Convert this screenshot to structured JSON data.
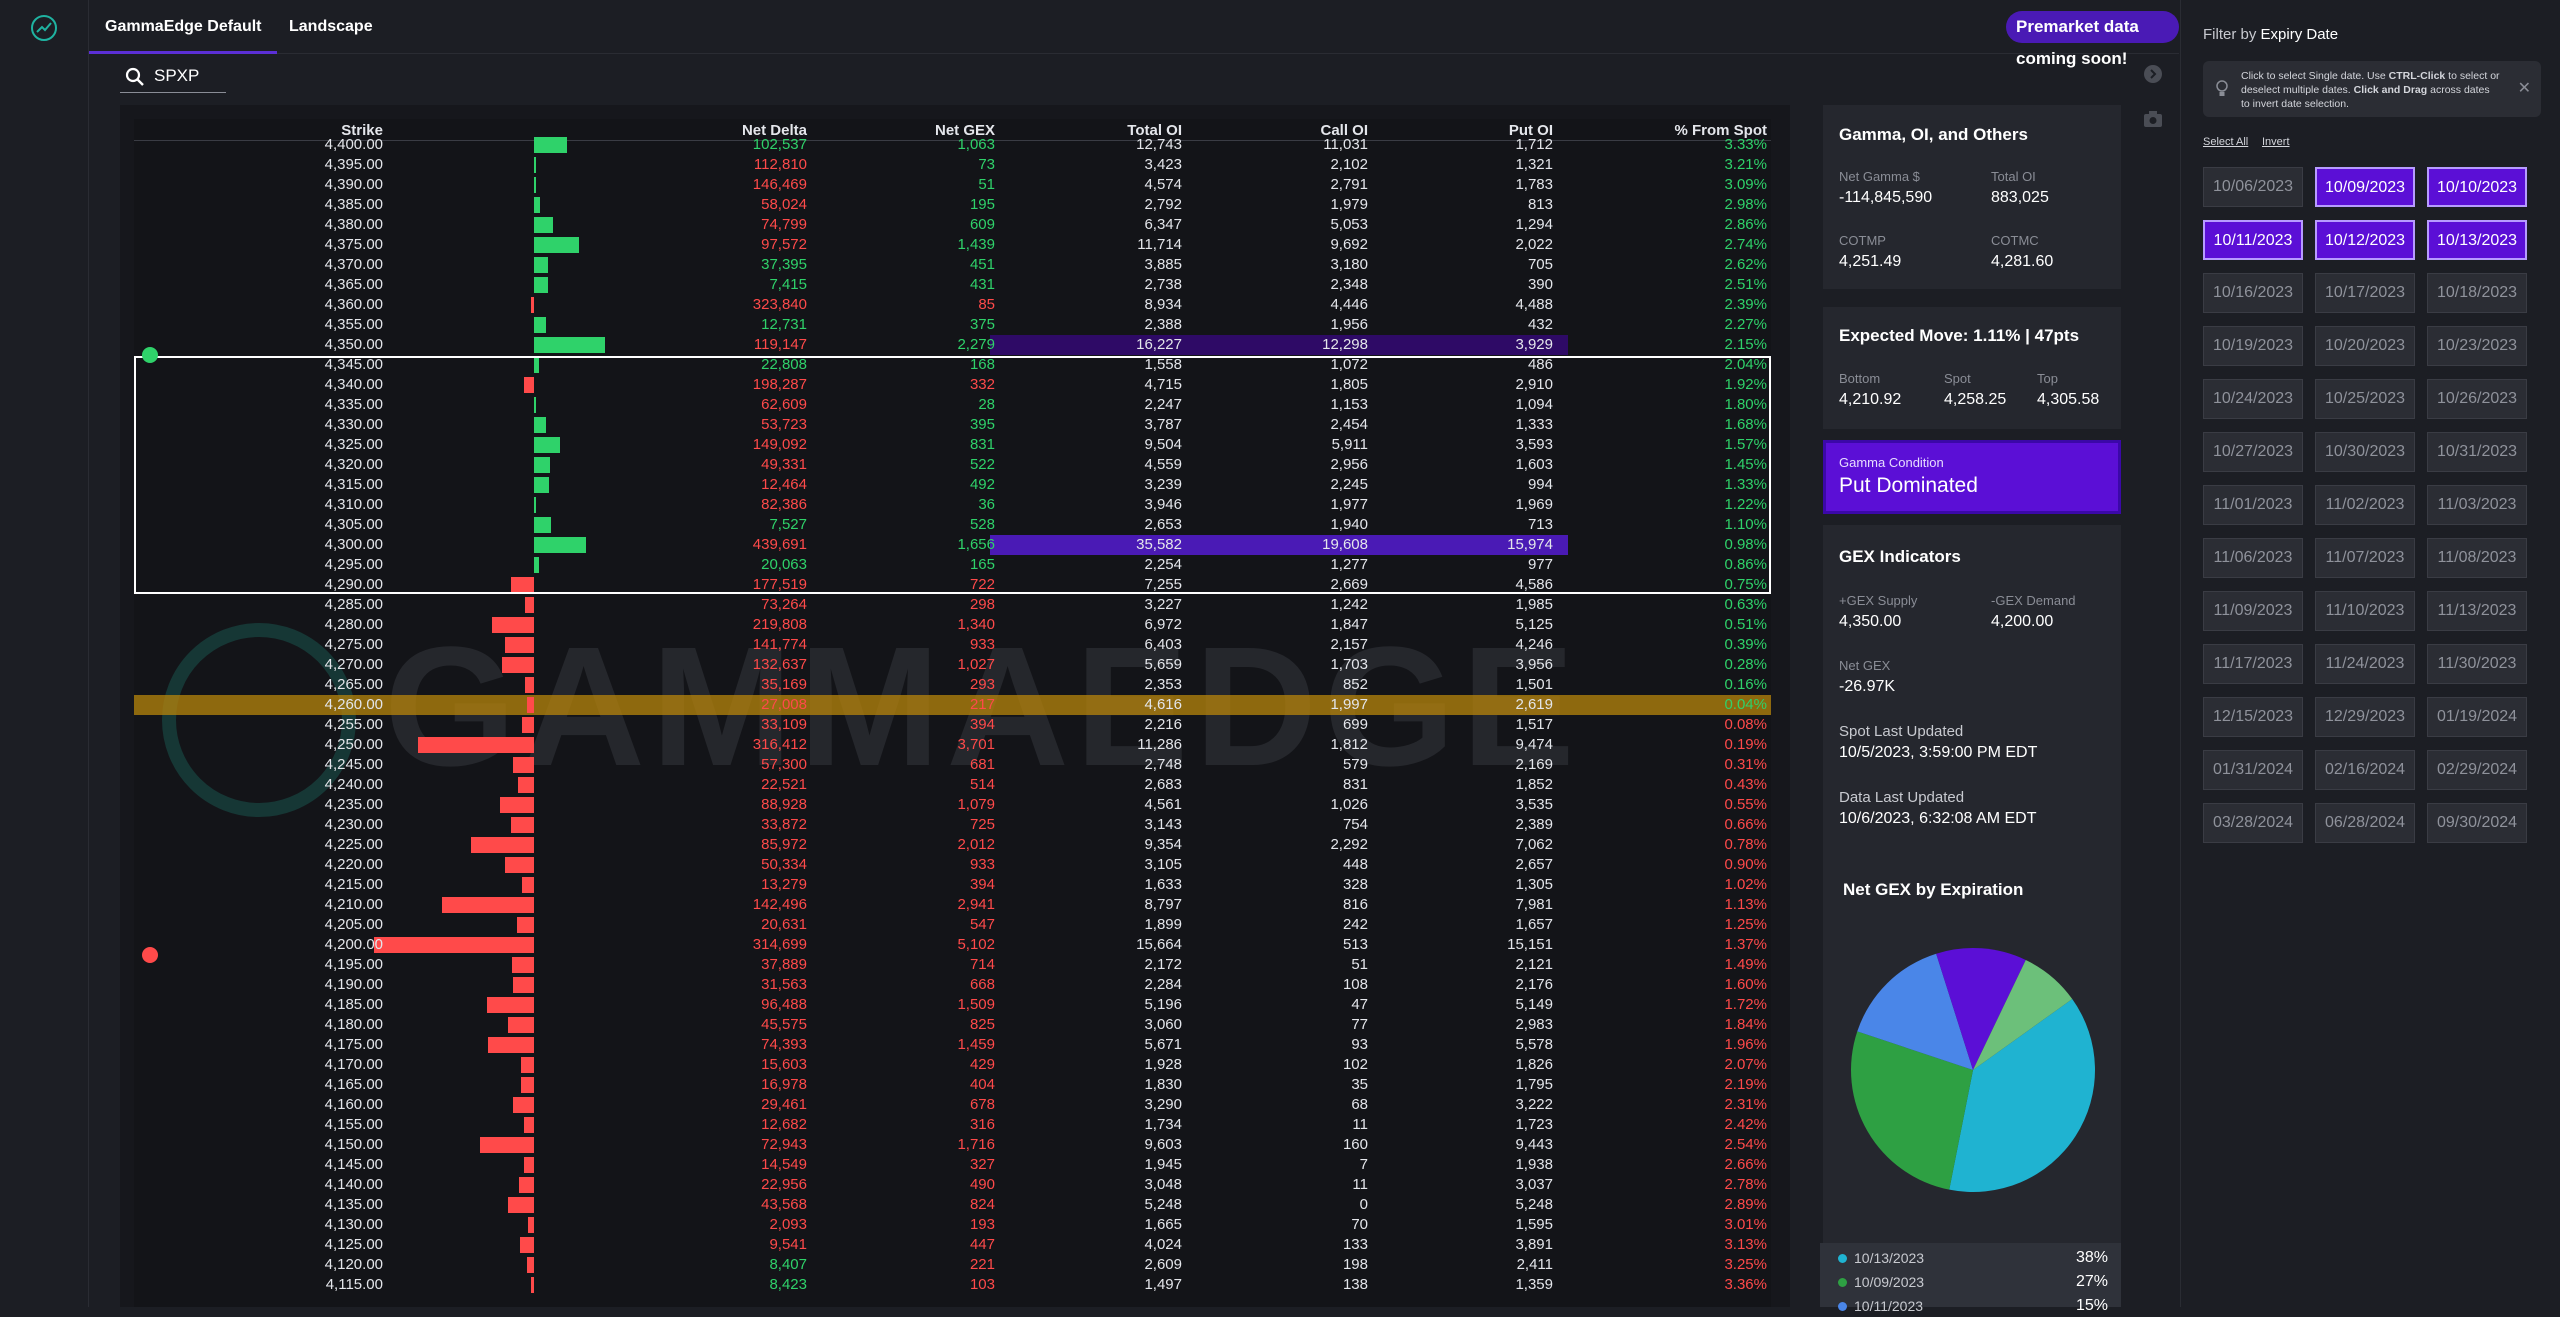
{
  "nav": {
    "tabs": [
      "GammaEdge Default",
      "Landscape"
    ],
    "active_tab": 0,
    "premarket_banner": "Premarket data coming soon!"
  },
  "search": {
    "value": "SPXP"
  },
  "table": {
    "columns": [
      "Strike",
      "Net Delta",
      "Net GEX",
      "Total OI",
      "Call OI",
      "Put OI",
      "% From Spot"
    ],
    "rows": [
      [
        "4,400.00",
        "102,537",
        "1,063",
        "12,743",
        "11,031",
        "1,712",
        "3.33%"
      ],
      [
        "4,395.00",
        "112,810",
        "73",
        "3,423",
        "2,102",
        "1,321",
        "3.21%"
      ],
      [
        "4,390.00",
        "146,469",
        "51",
        "4,574",
        "2,791",
        "1,783",
        "3.09%"
      ],
      [
        "4,385.00",
        "58,024",
        "195",
        "2,792",
        "1,979",
        "813",
        "2.98%"
      ],
      [
        "4,380.00",
        "74,799",
        "609",
        "6,347",
        "5,053",
        "1,294",
        "2.86%"
      ],
      [
        "4,375.00",
        "97,572",
        "1,439",
        "11,714",
        "9,692",
        "2,022",
        "2.74%"
      ],
      [
        "4,370.00",
        "37,395",
        "451",
        "3,885",
        "3,180",
        "705",
        "2.62%"
      ],
      [
        "4,365.00",
        "7,415",
        "431",
        "2,738",
        "2,348",
        "390",
        "2.51%"
      ],
      [
        "4,360.00",
        "323,840",
        "85",
        "8,934",
        "4,446",
        "4,488",
        "2.39%"
      ],
      [
        "4,355.00",
        "12,731",
        "375",
        "2,388",
        "1,956",
        "432",
        "2.27%"
      ],
      [
        "4,350.00",
        "119,147",
        "2,279",
        "16,227",
        "12,298",
        "3,929",
        "2.15%"
      ],
      [
        "4,345.00",
        "22,808",
        "168",
        "1,558",
        "1,072",
        "486",
        "2.04%"
      ],
      [
        "4,340.00",
        "198,287",
        "332",
        "4,715",
        "1,805",
        "2,910",
        "1.92%"
      ],
      [
        "4,335.00",
        "62,609",
        "28",
        "2,247",
        "1,153",
        "1,094",
        "1.80%"
      ],
      [
        "4,330.00",
        "53,723",
        "395",
        "3,787",
        "2,454",
        "1,333",
        "1.68%"
      ],
      [
        "4,325.00",
        "149,092",
        "831",
        "9,504",
        "5,911",
        "3,593",
        "1.57%"
      ],
      [
        "4,320.00",
        "49,331",
        "522",
        "4,559",
        "2,956",
        "1,603",
        "1.45%"
      ],
      [
        "4,315.00",
        "12,464",
        "492",
        "3,239",
        "2,245",
        "994",
        "1.33%"
      ],
      [
        "4,310.00",
        "82,386",
        "36",
        "3,946",
        "1,977",
        "1,969",
        "1.22%"
      ],
      [
        "4,305.00",
        "7,527",
        "528",
        "2,653",
        "1,940",
        "713",
        "1.10%"
      ],
      [
        "4,300.00",
        "439,691",
        "1,656",
        "35,582",
        "19,608",
        "15,974",
        "0.98%"
      ],
      [
        "4,295.00",
        "20,063",
        "165",
        "2,254",
        "1,277",
        "977",
        "0.86%"
      ],
      [
        "4,290.00",
        "177,519",
        "722",
        "7,255",
        "2,669",
        "4,586",
        "0.75%"
      ],
      [
        "4,285.00",
        "73,264",
        "298",
        "3,227",
        "1,242",
        "1,985",
        "0.63%"
      ],
      [
        "4,280.00",
        "219,808",
        "1,340",
        "6,972",
        "1,847",
        "5,125",
        "0.51%"
      ],
      [
        "4,275.00",
        "141,774",
        "933",
        "6,403",
        "2,157",
        "4,246",
        "0.39%"
      ],
      [
        "4,270.00",
        "132,637",
        "1,027",
        "5,659",
        "1,703",
        "3,956",
        "0.28%"
      ],
      [
        "4,265.00",
        "35,169",
        "293",
        "2,353",
        "852",
        "1,501",
        "0.16%"
      ],
      [
        "4,260.00",
        "27,008",
        "217",
        "4,616",
        "1,997",
        "2,619",
        "0.04%"
      ],
      [
        "4,255.00",
        "33,109",
        "394",
        "2,216",
        "699",
        "1,517",
        "0.08%"
      ],
      [
        "4,250.00",
        "316,412",
        "3,701",
        "11,286",
        "1,812",
        "9,474",
        "0.19%"
      ],
      [
        "4,245.00",
        "57,300",
        "681",
        "2,748",
        "579",
        "2,169",
        "0.31%"
      ],
      [
        "4,240.00",
        "22,521",
        "514",
        "2,683",
        "831",
        "1,852",
        "0.43%"
      ],
      [
        "4,235.00",
        "88,928",
        "1,079",
        "4,561",
        "1,026",
        "3,535",
        "0.55%"
      ],
      [
        "4,230.00",
        "33,872",
        "725",
        "3,143",
        "754",
        "2,389",
        "0.66%"
      ],
      [
        "4,225.00",
        "85,972",
        "2,012",
        "9,354",
        "2,292",
        "7,062",
        "0.78%"
      ],
      [
        "4,220.00",
        "50,334",
        "933",
        "3,105",
        "448",
        "2,657",
        "0.90%"
      ],
      [
        "4,215.00",
        "13,279",
        "394",
        "1,633",
        "328",
        "1,305",
        "1.02%"
      ],
      [
        "4,210.00",
        "142,496",
        "2,941",
        "8,797",
        "816",
        "7,981",
        "1.13%"
      ],
      [
        "4,205.00",
        "20,631",
        "547",
        "1,899",
        "242",
        "1,657",
        "1.25%"
      ],
      [
        "4,200.00",
        "314,699",
        "5,102",
        "15,664",
        "513",
        "15,151",
        "1.37%"
      ],
      [
        "4,195.00",
        "37,889",
        "714",
        "2,172",
        "51",
        "2,121",
        "1.49%"
      ],
      [
        "4,190.00",
        "31,563",
        "668",
        "2,284",
        "108",
        "2,176",
        "1.60%"
      ],
      [
        "4,185.00",
        "96,488",
        "1,509",
        "5,196",
        "47",
        "5,149",
        "1.72%"
      ],
      [
        "4,180.00",
        "45,575",
        "825",
        "3,060",
        "77",
        "2,983",
        "1.84%"
      ],
      [
        "4,175.00",
        "74,393",
        "1,459",
        "5,671",
        "93",
        "5,578",
        "1.96%"
      ],
      [
        "4,170.00",
        "15,603",
        "429",
        "1,928",
        "102",
        "1,826",
        "2.07%"
      ],
      [
        "4,165.00",
        "16,978",
        "404",
        "1,830",
        "35",
        "1,795",
        "2.19%"
      ],
      [
        "4,160.00",
        "29,461",
        "678",
        "3,290",
        "68",
        "3,222",
        "2.31%"
      ],
      [
        "4,155.00",
        "12,682",
        "316",
        "1,734",
        "11",
        "1,723",
        "2.42%"
      ],
      [
        "4,150.00",
        "72,943",
        "1,716",
        "9,603",
        "160",
        "9,443",
        "2.54%"
      ],
      [
        "4,145.00",
        "14,549",
        "327",
        "1,945",
        "7",
        "1,938",
        "2.66%"
      ],
      [
        "4,140.00",
        "22,956",
        "490",
        "3,048",
        "11",
        "3,037",
        "2.78%"
      ],
      [
        "4,135.00",
        "43,568",
        "824",
        "5,248",
        "0",
        "5,248",
        "2.89%"
      ],
      [
        "4,130.00",
        "2,093",
        "193",
        "1,665",
        "70",
        "1,595",
        "3.01%"
      ],
      [
        "4,125.00",
        "9,541",
        "447",
        "4,024",
        "133",
        "3,891",
        "3.13%"
      ],
      [
        "4,120.00",
        "8,407",
        "221",
        "2,609",
        "198",
        "2,411",
        "3.25%"
      ],
      [
        "4,115.00",
        "8,423",
        "103",
        "1,497",
        "138",
        "1,359",
        "3.36%"
      ]
    ],
    "row_colors": [
      "g",
      "r",
      "r",
      "r",
      "r",
      "r",
      "g",
      "g",
      "r",
      "g",
      "r",
      "g",
      "r",
      "r",
      "r",
      "r",
      "r",
      "r",
      "r",
      "g",
      "r",
      "g",
      "r",
      "r",
      "r",
      "r",
      "r",
      "r",
      "r",
      "r",
      "r",
      "r",
      "r",
      "r",
      "r",
      "r",
      "r",
      "r",
      "r",
      "r",
      "r",
      "r",
      "r",
      "r",
      "r",
      "r",
      "r",
      "r",
      "r",
      "r",
      "r",
      "r",
      "r",
      "r",
      "r",
      "r",
      "g",
      "g"
    ],
    "gex_sign": [
      "g",
      "g",
      "g",
      "g",
      "g",
      "g",
      "g",
      "g",
      "r",
      "g",
      "g",
      "g",
      "r",
      "g",
      "g",
      "g",
      "g",
      "g",
      "g",
      "g",
      "g",
      "g",
      "r",
      "r",
      "r",
      "r",
      "r",
      "r",
      "r",
      "r",
      "r",
      "r",
      "r",
      "r",
      "r",
      "r",
      "r",
      "r",
      "r",
      "r",
      "r",
      "r",
      "r",
      "r",
      "r",
      "r",
      "r",
      "r",
      "r",
      "r",
      "r",
      "r",
      "r",
      "r",
      "r",
      "r",
      "r",
      "r"
    ],
    "pct_color": [
      "g",
      "g",
      "g",
      "g",
      "g",
      "g",
      "g",
      "g",
      "g",
      "g",
      "g",
      "g",
      "g",
      "g",
      "g",
      "g",
      "g",
      "g",
      "g",
      "g",
      "g",
      "g",
      "g",
      "g",
      "g",
      "g",
      "g",
      "g",
      "g",
      "r",
      "r",
      "r",
      "r",
      "r",
      "r",
      "r",
      "r",
      "r",
      "r",
      "r",
      "r",
      "r",
      "r",
      "r",
      "r",
      "r",
      "r",
      "r",
      "r",
      "r",
      "r",
      "r",
      "r",
      "r",
      "r",
      "r",
      "r",
      "r"
    ],
    "net_gex_signed": [
      1063,
      73,
      51,
      195,
      609,
      1439,
      451,
      431,
      -85,
      375,
      2279,
      168,
      -332,
      28,
      395,
      831,
      522,
      492,
      36,
      528,
      1656,
      165,
      -722,
      -298,
      -1340,
      -933,
      -1027,
      -293,
      -217,
      -394,
      -3701,
      -681,
      -514,
      -1079,
      -725,
      -2012,
      -933,
      -394,
      -2941,
      -547,
      -5102,
      -714,
      -668,
      -1509,
      -825,
      -1459,
      -429,
      -404,
      -678,
      -316,
      -1716,
      -327,
      -490,
      -824,
      -193,
      -447,
      -221,
      -103
    ],
    "highlight_rows": [
      10,
      20
    ],
    "spot_row": 28
  },
  "watermark": "GAMMAEDGE",
  "gamma_card": {
    "title": "Gamma, OI, and Others",
    "net_gamma_label": "Net Gamma $",
    "net_gamma": "-114,845,590",
    "total_oi_label": "Total OI",
    "total_oi": "883,025",
    "cotmp_label": "COTMP",
    "cotmp": "4,251.49",
    "cotmc_label": "COTMC",
    "cotmc": "4,281.60"
  },
  "move_card": {
    "title": "Expected Move: 1.11% | 47pts",
    "bottom_label": "Bottom",
    "bottom": "4,210.92",
    "spot_label": "Spot",
    "spot": "4,258.25",
    "top_label": "Top",
    "top": "4,305.58"
  },
  "condition": {
    "label": "Gamma Condition",
    "value": "Put Dominated"
  },
  "gex_card": {
    "title": "GEX Indicators",
    "supply_label": "+GEX Supply",
    "supply": "4,350.00",
    "demand_label": "-GEX Demand",
    "demand": "4,200.00",
    "net_gex_label": "Net GEX",
    "net_gex": "-26.97K",
    "spot_updated_label": "Spot Last Updated",
    "spot_updated": "10/5/2023, 3:59:00 PM EDT",
    "data_updated_label": "Data Last Updated",
    "data_updated": "10/6/2023, 6:32:08 AM EDT"
  },
  "pie_card": {
    "title": "Net GEX by Expiration"
  },
  "chart_data": {
    "type": "pie",
    "title": "Net GEX by Expiration",
    "slices": [
      {
        "label": "10/13/2023",
        "value": 38,
        "color": "#1fb3d1"
      },
      {
        "label": "10/09/2023",
        "value": 27,
        "color": "#2ea043"
      },
      {
        "label": "10/11/2023",
        "value": 15,
        "color": "#4a86e8"
      },
      {
        "label": "",
        "value": 12,
        "color": "#5b0fd6"
      },
      {
        "label": "",
        "value": 8,
        "color": "#6cc07a"
      }
    ],
    "legend": [
      {
        "label": "10/13/2023",
        "pct": "38%",
        "color": "#1fb3d1"
      },
      {
        "label": "10/09/2023",
        "pct": "27%",
        "color": "#2ea043"
      },
      {
        "label": "10/11/2023",
        "pct": "15%",
        "color": "#4a86e8"
      }
    ]
  },
  "filter": {
    "title_prefix": "Filter by ",
    "title_bold": "Expiry Date",
    "hint_a": "Click to select Single date. Use ",
    "hint_b": "CTRL-Click",
    "hint_c": " to select or deselect multiple dates. ",
    "hint_d": "Click and Drag",
    "hint_e": " across dates to invert date selection.",
    "select_all": "Select All",
    "invert": "Invert",
    "dates": [
      "10/06/2023",
      "10/09/2023",
      "10/10/2023",
      "10/11/2023",
      "10/12/2023",
      "10/13/2023",
      "10/16/2023",
      "10/17/2023",
      "10/18/2023",
      "10/19/2023",
      "10/20/2023",
      "10/23/2023",
      "10/24/2023",
      "10/25/2023",
      "10/26/2023",
      "10/27/2023",
      "10/30/2023",
      "10/31/2023",
      "11/01/2023",
      "11/02/2023",
      "11/03/2023",
      "11/06/2023",
      "11/07/2023",
      "11/08/2023",
      "11/09/2023",
      "11/10/2023",
      "11/13/2023",
      "11/17/2023",
      "11/24/2023",
      "11/30/2023",
      "12/15/2023",
      "12/29/2023",
      "01/19/2024",
      "01/31/2024",
      "02/16/2024",
      "02/29/2024",
      "03/28/2024",
      "06/28/2024",
      "09/30/2024"
    ],
    "selected": [
      1,
      2,
      3,
      4,
      5
    ]
  }
}
